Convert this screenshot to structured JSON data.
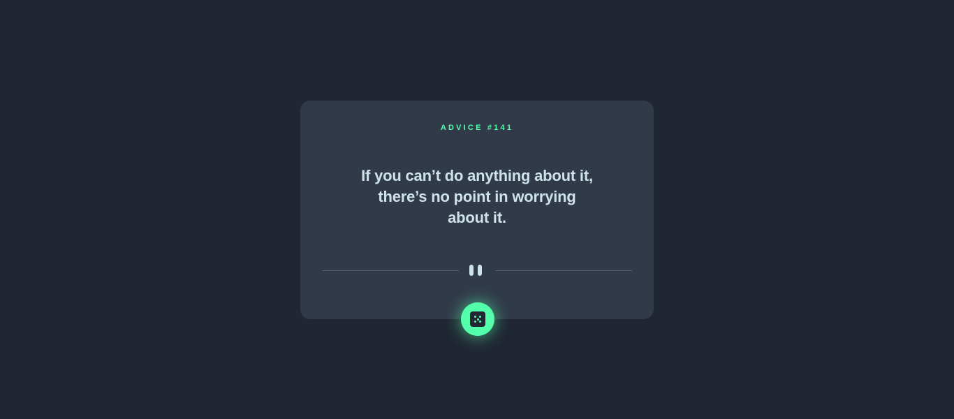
{
  "card": {
    "advice_label": "ADVICE #141",
    "quote_line_1": "If you can’t do anything about it,",
    "quote_line_2": "there’s no point in worrying",
    "quote_line_3": "about it."
  },
  "divider": {
    "icon": "pause-icon"
  },
  "generate_button": {
    "icon": "dice-icon"
  },
  "colors": {
    "background": "#202632",
    "card": "#313a49",
    "accent": "#53ffaa",
    "text": "#cee3e9",
    "divider": "#4f5d74"
  }
}
